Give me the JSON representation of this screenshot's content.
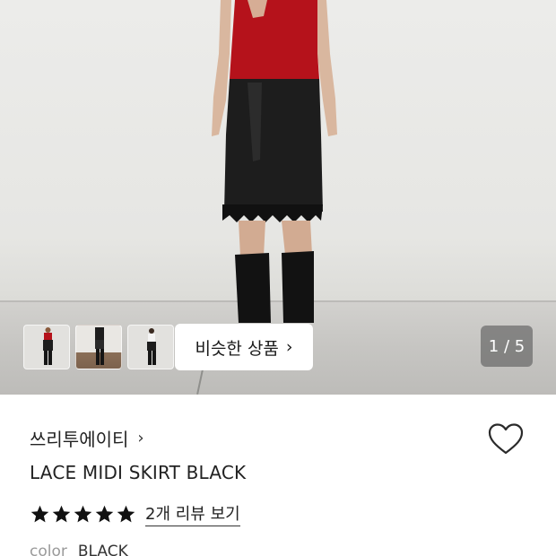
{
  "gallery": {
    "similar_products_label": "비슷한 상품",
    "page_current": "1",
    "page_total": "5",
    "page_indicator": "1 / 5",
    "thumbnails": [
      "thumbnail-1",
      "thumbnail-2",
      "thumbnail-3"
    ]
  },
  "product": {
    "brand": "쓰리투에이티",
    "name": "LACE MIDI SKIRT BLACK",
    "rating": 5,
    "rating_max": 5,
    "review_link": "2개 리뷰 보기",
    "option_label": "color",
    "option_value": "BLACK"
  },
  "icons": {
    "wishlist": "heart-outline-icon",
    "star": "star-filled-icon",
    "chevron": "chevron-right-icon"
  },
  "colors": {
    "star": "#111111",
    "text": "#222222",
    "muted": "#9a9a9a"
  }
}
